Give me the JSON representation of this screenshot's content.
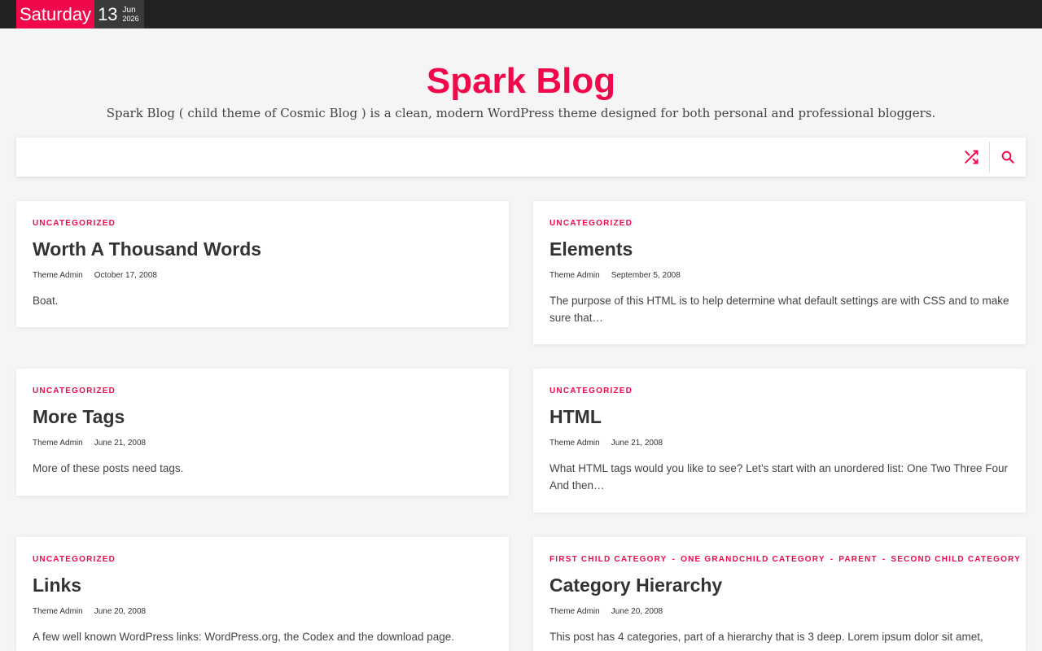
{
  "topbar": {
    "day": "Saturday",
    "date": "13",
    "month": "Jun",
    "year": "2026"
  },
  "site": {
    "title": "Spark Blog",
    "tagline": "Spark Blog ( child theme of Cosmic Blog ) is a clean, modern WordPress theme designed for both personal and professional bloggers."
  },
  "nav": {
    "random_icon": "shuffle-icon",
    "search_icon": "search-icon"
  },
  "colors": {
    "accent": "#f0094a",
    "topbar": "#222222"
  },
  "posts": [
    {
      "categories": [
        "UNCATEGORIZED"
      ],
      "title": "Worth A Thousand Words",
      "author": "Theme Admin",
      "date": "October 17, 2008",
      "excerpt": "Boat."
    },
    {
      "categories": [
        "UNCATEGORIZED"
      ],
      "title": "Elements",
      "author": "Theme Admin",
      "date": "September 5, 2008",
      "excerpt": "The purpose of this HTML is to help determine what default settings are with CSS and to make sure that…"
    },
    {
      "categories": [
        "UNCATEGORIZED"
      ],
      "title": "More Tags",
      "author": "Theme Admin",
      "date": "June 21, 2008",
      "excerpt": "More of these posts need tags."
    },
    {
      "categories": [
        "UNCATEGORIZED"
      ],
      "title": "HTML",
      "author": "Theme Admin",
      "date": "June 21, 2008",
      "excerpt": "What HTML tags would you like to see? Let’s start with an unordered list: One Two Three Four And then…"
    },
    {
      "categories": [
        "UNCATEGORIZED"
      ],
      "title": "Links",
      "author": "Theme Admin",
      "date": "June 20, 2008",
      "excerpt": "A few well known WordPress links: WordPress.org, the Codex and the download page."
    },
    {
      "categories": [
        "FIRST CHILD CATEGORY",
        "ONE GRANDCHILD CATEGORY",
        "PARENT",
        "SECOND CHILD CATEGORY"
      ],
      "category_separator": "-",
      "title": "Category Hierarchy",
      "author": "Theme Admin",
      "date": "June 20, 2008",
      "excerpt": "This post has 4 categories, part of a hierarchy that is 3 deep. Lorem ipsum dolor sit amet,"
    }
  ]
}
